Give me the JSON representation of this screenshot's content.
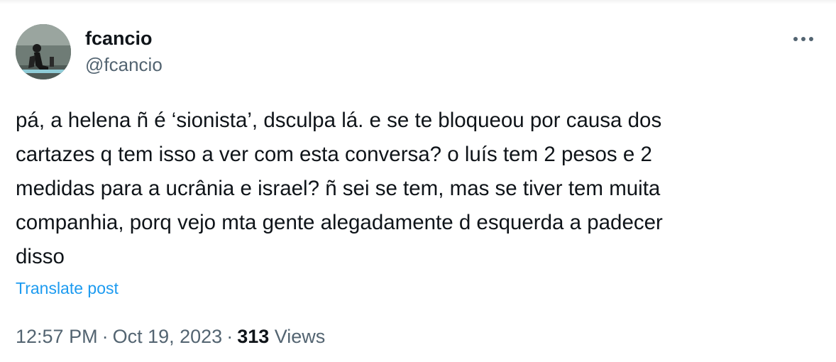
{
  "tweet": {
    "author": {
      "display_name": "fcancio",
      "handle": "@fcancio",
      "avatar_icon": "profile-photo"
    },
    "more_icon": "ellipsis-icon",
    "text": "pá, a helena ñ é ‘sionista’, dsculpa lá. e se te bloqueou por causa dos\ncartazes q tem isso a ver com esta conversa? o luís tem 2 pesos e 2\nmedidas para a ucrânia e israel? ñ sei se tem, mas se tiver tem muita\ncompanhia, porq vejo mta gente alegadamente d esquerda a padecer\ndisso",
    "translate_label": "Translate post",
    "time": "12:57 PM",
    "date": "Oct 19, 2023",
    "separator": "·",
    "views_count": "313",
    "views_label": "Views"
  },
  "colors": {
    "text_primary": "#0f1419",
    "text_secondary": "#536471",
    "link": "#1d9bf0"
  }
}
